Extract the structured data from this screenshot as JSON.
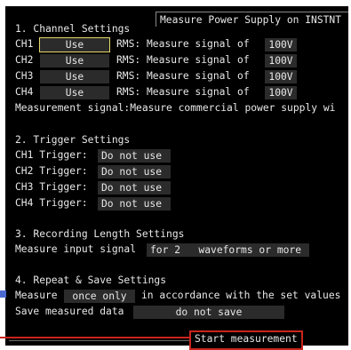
{
  "header": {
    "title": "Measure Power Supply on INSTNT"
  },
  "section1": {
    "heading": "1. Channel Settings",
    "channels": [
      {
        "name": "CH1",
        "use": "Use",
        "rms_label": "RMS: Measure signal of",
        "voltage": "100V"
      },
      {
        "name": "CH2",
        "use": "Use",
        "rms_label": "RMS: Measure signal of",
        "voltage": "100V"
      },
      {
        "name": "CH3",
        "use": "Use",
        "rms_label": "RMS: Measure signal of",
        "voltage": "100V"
      },
      {
        "name": "CH4",
        "use": "Use",
        "rms_label": "RMS: Measure signal of",
        "voltage": "100V"
      }
    ],
    "note": "Measurement signal:Measure commercial power supply wi"
  },
  "section2": {
    "heading": "2. Trigger Settings",
    "triggers": [
      {
        "label": "CH1 Trigger:",
        "value": "Do not use"
      },
      {
        "label": "CH2 Trigger:",
        "value": "Do not use"
      },
      {
        "label": "CH3 Trigger:",
        "value": "Do not use"
      },
      {
        "label": "CH4 Trigger:",
        "value": "Do not use"
      }
    ]
  },
  "section3": {
    "heading": "3. Recording Length Settings",
    "label": "Measure input signal",
    "value": "for 2   waveforms or more"
  },
  "section4": {
    "heading": "4. Repeat & Save Settings",
    "measure_label": "Measure",
    "measure_value": "once only",
    "measure_suffix": "in accordance with the set values",
    "save_label": "Save measured data",
    "save_value": "do not save"
  },
  "start_button": {
    "label": "Start measurement"
  },
  "colors": {
    "background": "#000000",
    "text": "#e8e8e8",
    "field": "#2b2b2b",
    "focus": "#e6d86a",
    "callout": "#c8251e"
  }
}
